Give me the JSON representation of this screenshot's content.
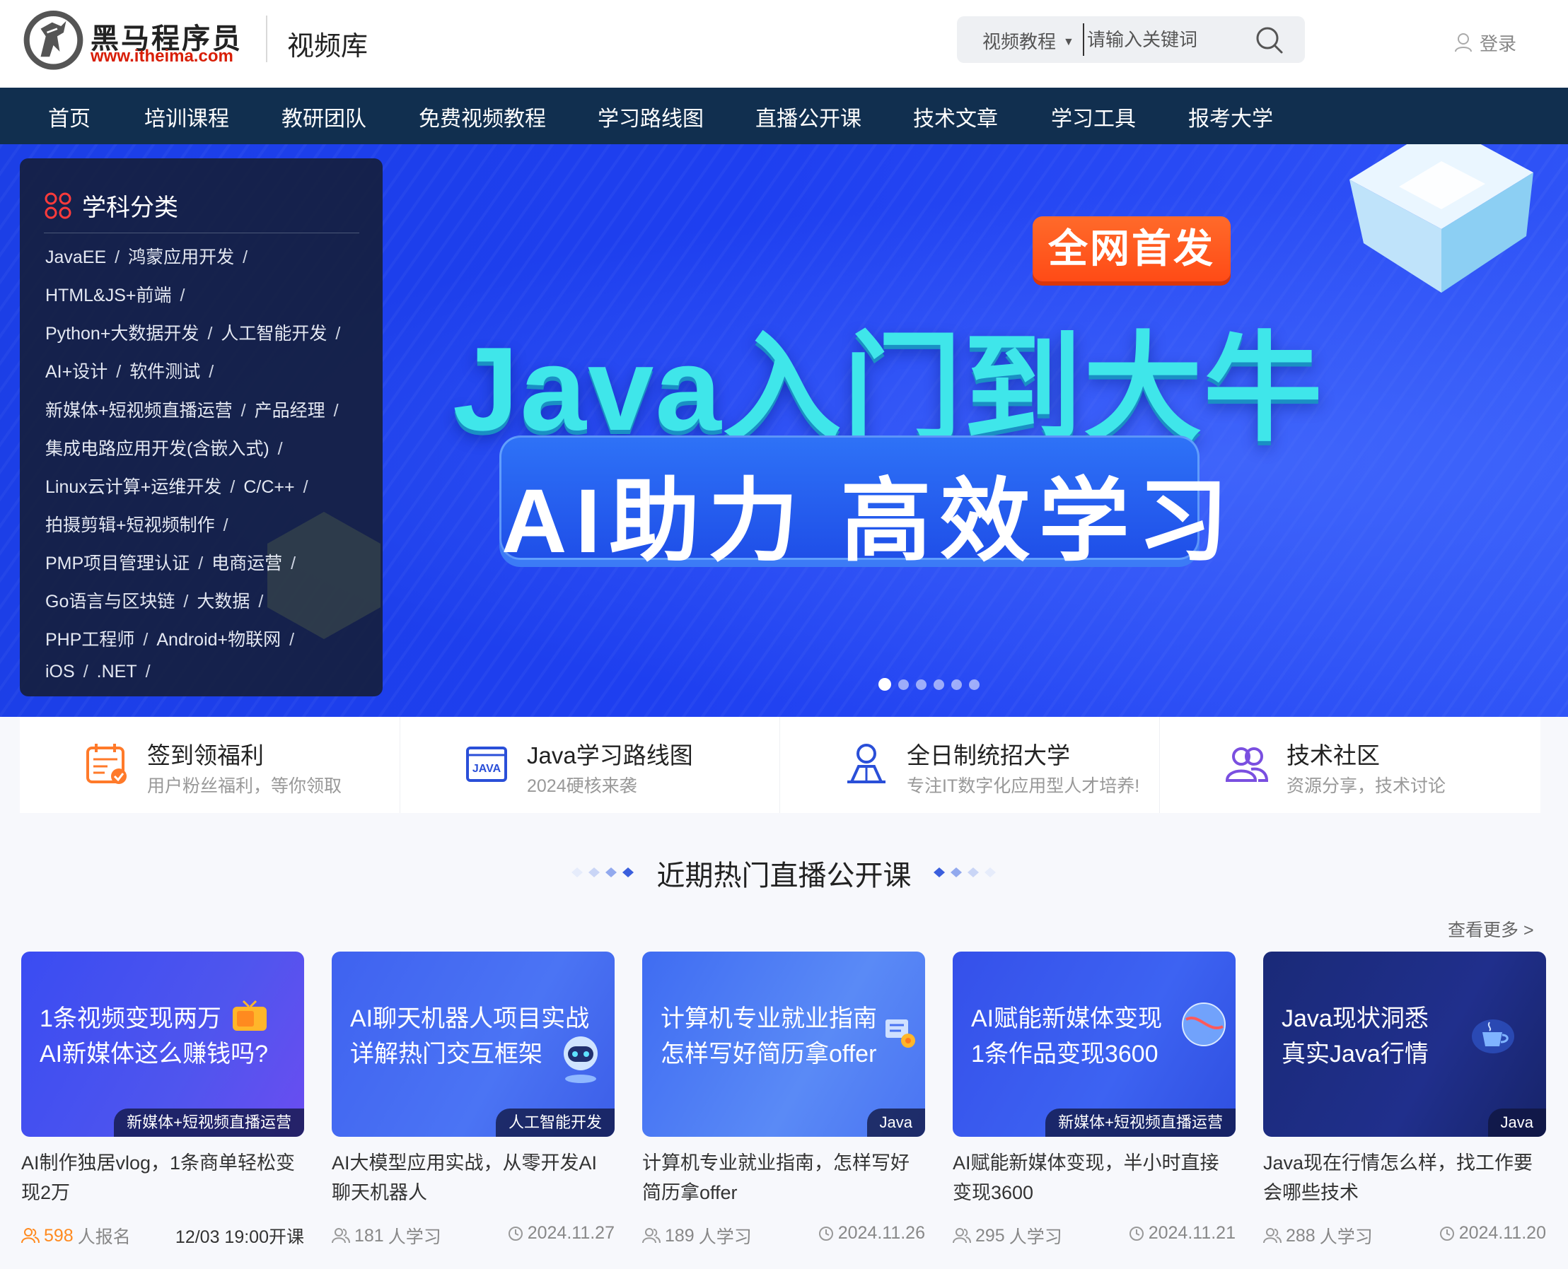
{
  "header": {
    "brand_name": "黑马程序员",
    "brand_url": "www.itheima.com",
    "section": "视频库",
    "search_type": "视频教程",
    "search_placeholder": "请输入关键词",
    "login": "登录"
  },
  "nav": [
    "首页",
    "培训课程",
    "教研团队",
    "免费视频教程",
    "学习路线图",
    "直播公开课",
    "技术文章",
    "学习工具",
    "报考大学"
  ],
  "categories": {
    "title": "学科分类",
    "rows": [
      [
        "JavaEE",
        "鸿蒙应用开发"
      ],
      [
        "HTML&JS+前端"
      ],
      [
        "Python+大数据开发",
        "人工智能开发"
      ],
      [
        "AI+设计",
        "软件测试"
      ],
      [
        "新媒体+短视频直播运营",
        "产品经理"
      ],
      [
        "集成电路应用开发(含嵌入式)"
      ],
      [
        "Linux云计算+运维开发",
        "C/C++"
      ],
      [
        "拍摄剪辑+短视频制作"
      ],
      [
        "PMP项目管理认证",
        "电商运营"
      ],
      [
        "Go语言与区块链",
        "大数据"
      ],
      [
        "PHP工程师",
        "Android+物联网"
      ],
      [
        "iOS",
        ".NET"
      ]
    ],
    "separator": "/"
  },
  "banner": {
    "badge": "全网首发",
    "title": "Java入门到大牛",
    "subtitle": "AI助力 高效学习",
    "slides": 6,
    "active_slide": 1
  },
  "quick_links": [
    {
      "title": "签到领福利",
      "subtitle": "用户粉丝福利，等你领取",
      "icon": "calendar-check-icon"
    },
    {
      "title": "Java学习路线图",
      "subtitle": "2024硬核来袭",
      "icon": "java-icon"
    },
    {
      "title": "全日制统招大学",
      "subtitle": "专注IT数字化应用型人才培养!",
      "icon": "student-icon"
    },
    {
      "title": "技术社区",
      "subtitle": "资源分享，技术讨论",
      "icon": "community-icon"
    }
  ],
  "section": {
    "title": "近期热门直播公开课",
    "see_more": "查看更多 >"
  },
  "courses": [
    {
      "line1": "1条视频变现两万",
      "line2": "AI新媒体这么赚钱吗?",
      "tag": "新媒体+短视频直播运营",
      "desc": "AI制作独居vlog，1条商单轻松变现2万",
      "count": "598",
      "count_suffix": "人报名",
      "date": "12/03 19:00开课",
      "highlight": true
    },
    {
      "line1": "AI聊天机器人项目实战",
      "line2": "详解热门交互框架",
      "tag": "人工智能开发",
      "desc": "AI大模型应用实战，从零开发AI聊天机器人",
      "count": "181",
      "count_suffix": "人学习",
      "date": "2024.11.27",
      "highlight": false
    },
    {
      "line1": "计算机专业就业指南",
      "line2": "怎样写好简历拿offer",
      "tag": "Java",
      "desc": "计算机专业就业指南，怎样写好简历拿offer",
      "count": "189",
      "count_suffix": "人学习",
      "date": "2024.11.26",
      "highlight": false
    },
    {
      "line1": "AI赋能新媒体变现",
      "line2": "1条作品变现3600",
      "tag": "新媒体+短视频直播运营",
      "desc": "AI赋能新媒体变现，半小时直接变现3600",
      "count": "295",
      "count_suffix": "人学习",
      "date": "2024.11.21",
      "highlight": false
    },
    {
      "line1": "Java现状洞悉",
      "line2": "真实Java行情",
      "tag": "Java",
      "desc": "Java现在行情怎么样，找工作要会哪些技术",
      "count": "288",
      "count_suffix": "人学习",
      "date": "2024.11.20",
      "highlight": false
    }
  ],
  "colors": {
    "nav_bg": "#112f4f",
    "banner_bg": "#1e3ff0",
    "accent_orange": "#ff8a1f",
    "brand_red": "#d81e06"
  }
}
